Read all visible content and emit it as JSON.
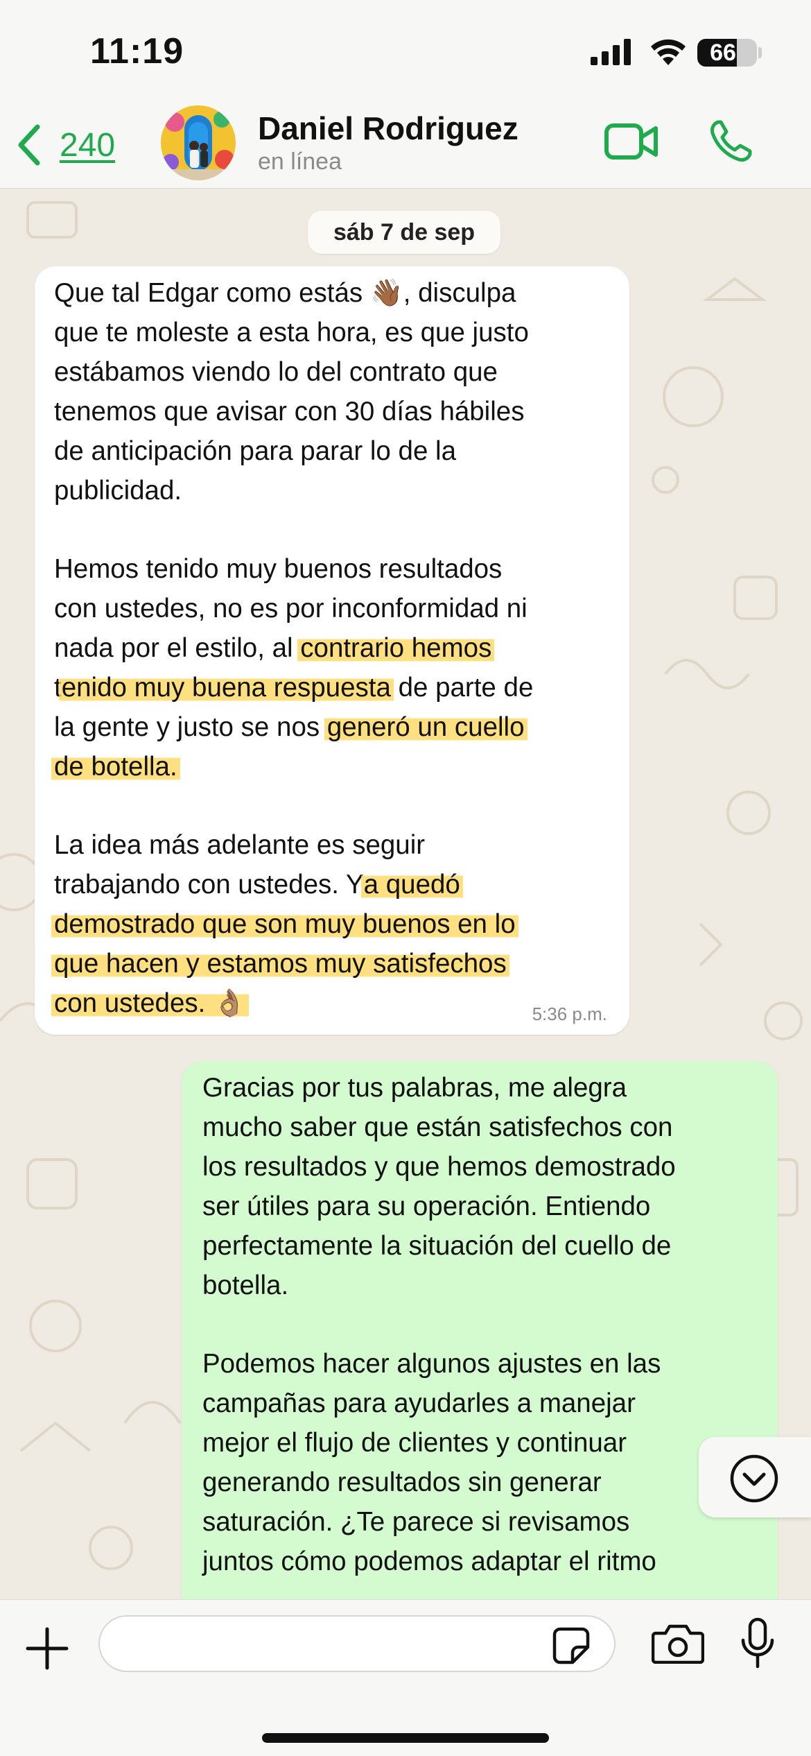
{
  "status_bar": {
    "time": "11:19",
    "battery": "66",
    "battery_level": 0.66
  },
  "header": {
    "back_count": "240",
    "contact_name": "Daniel Rodriguez",
    "contact_status": "en línea"
  },
  "chat": {
    "date_label": "sáb 7 de sep",
    "incoming": {
      "time": "5:36 p.m.",
      "lines": [
        [
          {
            "t": "Que tal Edgar como estás 👋🏾, disculpa"
          }
        ],
        [
          {
            "t": "que te moleste a esta hora, es que justo"
          }
        ],
        [
          {
            "t": "estábamos viendo lo del contrato que"
          }
        ],
        [
          {
            "t": "tenemos que avisar con 30 días hábiles"
          }
        ],
        [
          {
            "t": "de anticipación para parar lo de la"
          }
        ],
        [
          {
            "t": "publicidad."
          }
        ],
        [],
        [
          {
            "t": "Hemos tenido muy buenos resultados"
          }
        ],
        [
          {
            "t": "con ustedes, no es por inconformidad ni"
          }
        ],
        [
          {
            "t": "nada por el estilo, al "
          },
          {
            "t": "contrario hemos",
            "h": true
          }
        ],
        [
          {
            "t": "t"
          },
          {
            "t": "enido muy buena respuesta",
            "h": true
          },
          {
            "t": " de parte de"
          }
        ],
        [
          {
            "t": "la gente y justo se nos "
          },
          {
            "t": "generó un cuello",
            "h": true
          }
        ],
        [
          {
            "t": "de botella.",
            "h": true
          }
        ],
        [],
        [
          {
            "t": "La idea más adelante es seguir"
          }
        ],
        [
          {
            "t": "trabajando con ustedes. Y"
          },
          {
            "t": "a quedó",
            "h": true
          }
        ],
        [
          {
            "t": "demostrado que son muy buenos en lo",
            "h": true
          }
        ],
        [
          {
            "t": "que hacen y estamos muy satisfechos",
            "h": true
          }
        ],
        [
          {
            "t": "con ustedes. 👌🏽",
            "h": true
          }
        ]
      ]
    },
    "outgoing": {
      "lines": [
        [
          {
            "t": "Gracias por tus palabras, me alegra"
          }
        ],
        [
          {
            "t": "mucho saber que están satisfechos con"
          }
        ],
        [
          {
            "t": "los resultados y que hemos demostrado"
          }
        ],
        [
          {
            "t": "ser útiles para su operación. Entiendo"
          }
        ],
        [
          {
            "t": "perfectamente la situación del cuello de"
          }
        ],
        [
          {
            "t": "botella."
          }
        ],
        [],
        [
          {
            "t": "Podemos hacer algunos ajustes en las"
          }
        ],
        [
          {
            "t": "campañas para ayudarles a manejar"
          }
        ],
        [
          {
            "t": "mejor el flujo de clientes y continuar"
          }
        ],
        [
          {
            "t": "generando resultados sin generar"
          }
        ],
        [
          {
            "t": "saturación. ¿Te parece si revisamos"
          }
        ],
        [
          {
            "t": "juntos cómo podemos adaptar el ritmo"
          }
        ]
      ]
    }
  },
  "input_bar": {
    "message_value": ""
  },
  "icons": {
    "back": "chevron-left-icon",
    "video": "video-camera-icon",
    "call": "phone-icon",
    "scroll": "chevron-down-circle-icon",
    "plus": "plus-icon",
    "sticker": "sticker-icon",
    "camera": "camera-icon",
    "mic": "microphone-icon"
  },
  "colors": {
    "accent": "#1faa4e",
    "incoming_bubble": "#ffffff",
    "outgoing_bubble": "#d4fbd0",
    "highlight": "#ffd555",
    "background": "#efeae2"
  }
}
